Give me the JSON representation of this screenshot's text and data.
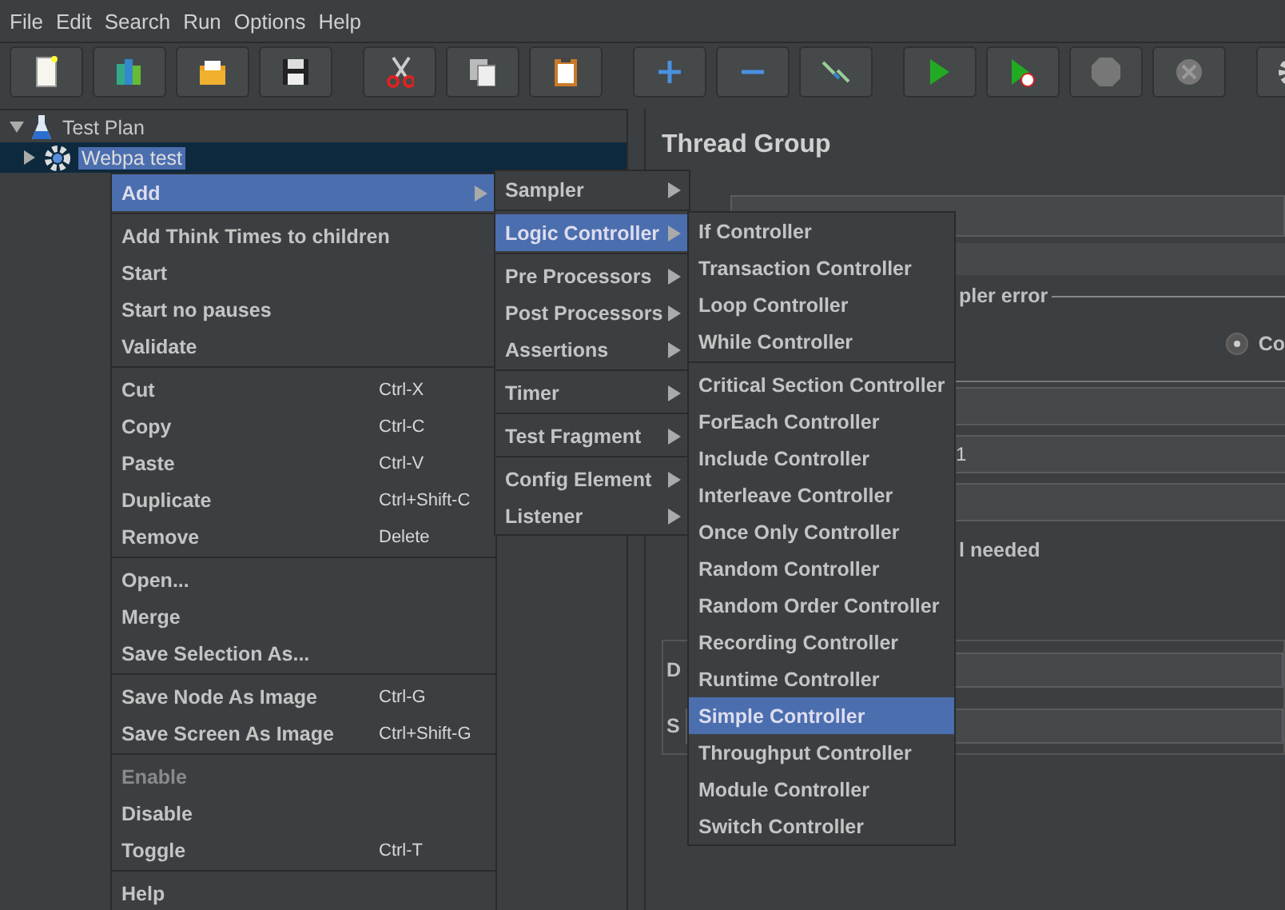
{
  "menubar": [
    "File",
    "Edit",
    "Search",
    "Run",
    "Options",
    "Help"
  ],
  "tree": [
    {
      "label": "Test Plan",
      "kind": "plan",
      "expanded": true,
      "selected": false,
      "children": [
        {
          "label": "Webpa test",
          "kind": "thread_group",
          "expanded": false,
          "selected": true
        }
      ]
    }
  ],
  "panel": {
    "title": "Thread Group",
    "legend_fragment": "pler error",
    "radio": {
      "label": "Co",
      "selected": true
    },
    "field_value": "1",
    "checkbox_fragment": "l needed",
    "label_fragments": [
      "D",
      "S"
    ]
  },
  "context_menu": [
    [
      {
        "label": "Add",
        "submenu": true,
        "selected": true,
        "disabled": false
      }
    ],
    [
      {
        "label": "Add Think Times to children",
        "submenu": false,
        "selected": false,
        "disabled": false
      },
      {
        "label": "Start",
        "submenu": false,
        "selected": false,
        "disabled": false
      },
      {
        "label": "Start no pauses",
        "submenu": false,
        "selected": false,
        "disabled": false
      },
      {
        "label": "Validate",
        "submenu": false,
        "selected": false,
        "disabled": false
      }
    ],
    [
      {
        "label": "Cut",
        "shortcut": "Ctrl-X",
        "submenu": false,
        "selected": false,
        "disabled": false
      },
      {
        "label": "Copy",
        "shortcut": "Ctrl-C",
        "submenu": false,
        "selected": false,
        "disabled": false
      },
      {
        "label": "Paste",
        "shortcut": "Ctrl-V",
        "submenu": false,
        "selected": false,
        "disabled": false
      },
      {
        "label": "Duplicate",
        "shortcut": "Ctrl+Shift-C",
        "submenu": false,
        "selected": false,
        "disabled": false
      },
      {
        "label": "Remove",
        "shortcut": "Delete",
        "submenu": false,
        "selected": false,
        "disabled": false
      }
    ],
    [
      {
        "label": "Open...",
        "submenu": false,
        "selected": false,
        "disabled": false
      },
      {
        "label": "Merge",
        "submenu": false,
        "selected": false,
        "disabled": false
      },
      {
        "label": "Save Selection As...",
        "submenu": false,
        "selected": false,
        "disabled": false
      }
    ],
    [
      {
        "label": "Save Node As Image",
        "shortcut": "Ctrl-G",
        "submenu": false,
        "selected": false,
        "disabled": false
      },
      {
        "label": "Save Screen As Image",
        "shortcut": "Ctrl+Shift-G",
        "submenu": false,
        "selected": false,
        "disabled": false
      }
    ],
    [
      {
        "label": "Enable",
        "submenu": false,
        "selected": false,
        "disabled": true
      },
      {
        "label": "Disable",
        "submenu": false,
        "selected": false,
        "disabled": false
      },
      {
        "label": "Toggle",
        "shortcut": "Ctrl-T",
        "submenu": false,
        "selected": false,
        "disabled": false
      }
    ],
    [
      {
        "label": "Help",
        "submenu": false,
        "selected": false,
        "disabled": false
      }
    ]
  ],
  "add_submenu": [
    [
      {
        "label": "Sampler",
        "submenu": true,
        "selected": false
      }
    ],
    [
      {
        "label": "Logic Controller",
        "submenu": true,
        "selected": true
      }
    ],
    [
      {
        "label": "Pre Processors",
        "submenu": true,
        "selected": false
      },
      {
        "label": "Post Processors",
        "submenu": true,
        "selected": false
      },
      {
        "label": "Assertions",
        "submenu": true,
        "selected": false
      }
    ],
    [
      {
        "label": "Timer",
        "submenu": true,
        "selected": false
      }
    ],
    [
      {
        "label": "Test Fragment",
        "submenu": true,
        "selected": false
      }
    ],
    [
      {
        "label": "Config Element",
        "submenu": true,
        "selected": false
      },
      {
        "label": "Listener",
        "submenu": true,
        "selected": false
      }
    ]
  ],
  "logic_submenu": [
    [
      {
        "label": "If Controller",
        "selected": false
      },
      {
        "label": "Transaction Controller",
        "selected": false
      },
      {
        "label": "Loop Controller",
        "selected": false
      },
      {
        "label": "While Controller",
        "selected": false
      }
    ],
    [
      {
        "label": "Critical Section Controller",
        "selected": false
      },
      {
        "label": "ForEach Controller",
        "selected": false
      },
      {
        "label": "Include Controller",
        "selected": false
      },
      {
        "label": "Interleave Controller",
        "selected": false
      },
      {
        "label": "Once Only Controller",
        "selected": false
      },
      {
        "label": "Random Controller",
        "selected": false
      },
      {
        "label": "Random Order Controller",
        "selected": false
      },
      {
        "label": "Recording Controller",
        "selected": false
      },
      {
        "label": "Runtime Controller",
        "selected": false
      },
      {
        "label": "Simple Controller",
        "selected": true
      },
      {
        "label": "Throughput Controller",
        "selected": false
      },
      {
        "label": "Module Controller",
        "selected": false
      },
      {
        "label": "Switch Controller",
        "selected": false
      }
    ]
  ]
}
